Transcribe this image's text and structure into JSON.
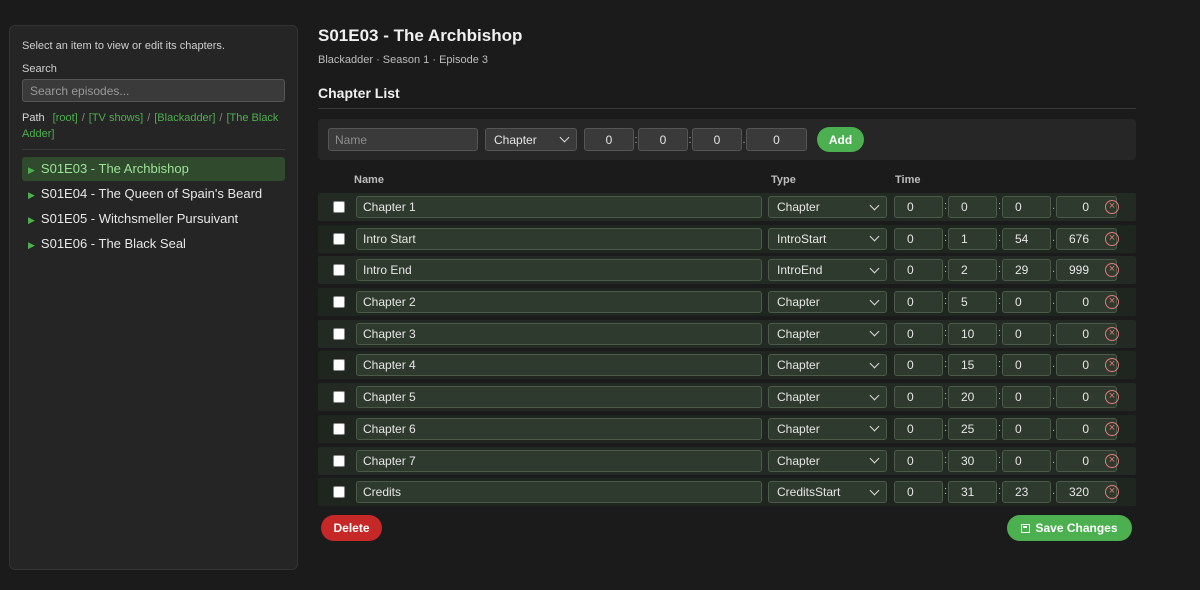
{
  "sidebar": {
    "hint": "Select an item to view or edit its chapters.",
    "search_label": "Search",
    "search_placeholder": "Search episodes...",
    "path_label": "Path",
    "path": [
      "[root]",
      "[TV shows]",
      "[Blackadder]",
      "[The Black Adder]"
    ],
    "episodes": [
      {
        "label": "S01E03 - The Archbishop",
        "active": true
      },
      {
        "label": "S01E04 - The Queen of Spain's Beard",
        "active": false
      },
      {
        "label": "S01E05 - Witchsmeller Pursuivant",
        "active": false
      },
      {
        "label": "S01E06 - The Black Seal",
        "active": false
      }
    ]
  },
  "main": {
    "title": "S01E03 - The Archbishop",
    "subtitle": "Blackadder · Season 1 · Episode 3",
    "section_title": "Chapter List",
    "add_bar": {
      "name_placeholder": "Name",
      "type": "Chapter",
      "h": "0",
      "m": "0",
      "s": "0",
      "ms": "0",
      "add_label": "Add"
    },
    "headers": {
      "name": "Name",
      "type": "Type",
      "time": "Time"
    },
    "chapters": [
      {
        "name": "Chapter 1",
        "type": "Chapter",
        "h": "0",
        "m": "0",
        "s": "0",
        "ms": "0"
      },
      {
        "name": "Intro Start",
        "type": "IntroStart",
        "h": "0",
        "m": "1",
        "s": "54",
        "ms": "676"
      },
      {
        "name": "Intro End",
        "type": "IntroEnd",
        "h": "0",
        "m": "2",
        "s": "29",
        "ms": "999"
      },
      {
        "name": "Chapter 2",
        "type": "Chapter",
        "h": "0",
        "m": "5",
        "s": "0",
        "ms": "0"
      },
      {
        "name": "Chapter 3",
        "type": "Chapter",
        "h": "0",
        "m": "10",
        "s": "0",
        "ms": "0"
      },
      {
        "name": "Chapter 4",
        "type": "Chapter",
        "h": "0",
        "m": "15",
        "s": "0",
        "ms": "0"
      },
      {
        "name": "Chapter 5",
        "type": "Chapter",
        "h": "0",
        "m": "20",
        "s": "0",
        "ms": "0"
      },
      {
        "name": "Chapter 6",
        "type": "Chapter",
        "h": "0",
        "m": "25",
        "s": "0",
        "ms": "0"
      },
      {
        "name": "Chapter 7",
        "type": "Chapter",
        "h": "0",
        "m": "30",
        "s": "0",
        "ms": "0"
      },
      {
        "name": "Credits",
        "type": "CreditsStart",
        "h": "0",
        "m": "31",
        "s": "23",
        "ms": "320"
      }
    ],
    "delete_label": "Delete",
    "save_label": "Save Changes"
  }
}
